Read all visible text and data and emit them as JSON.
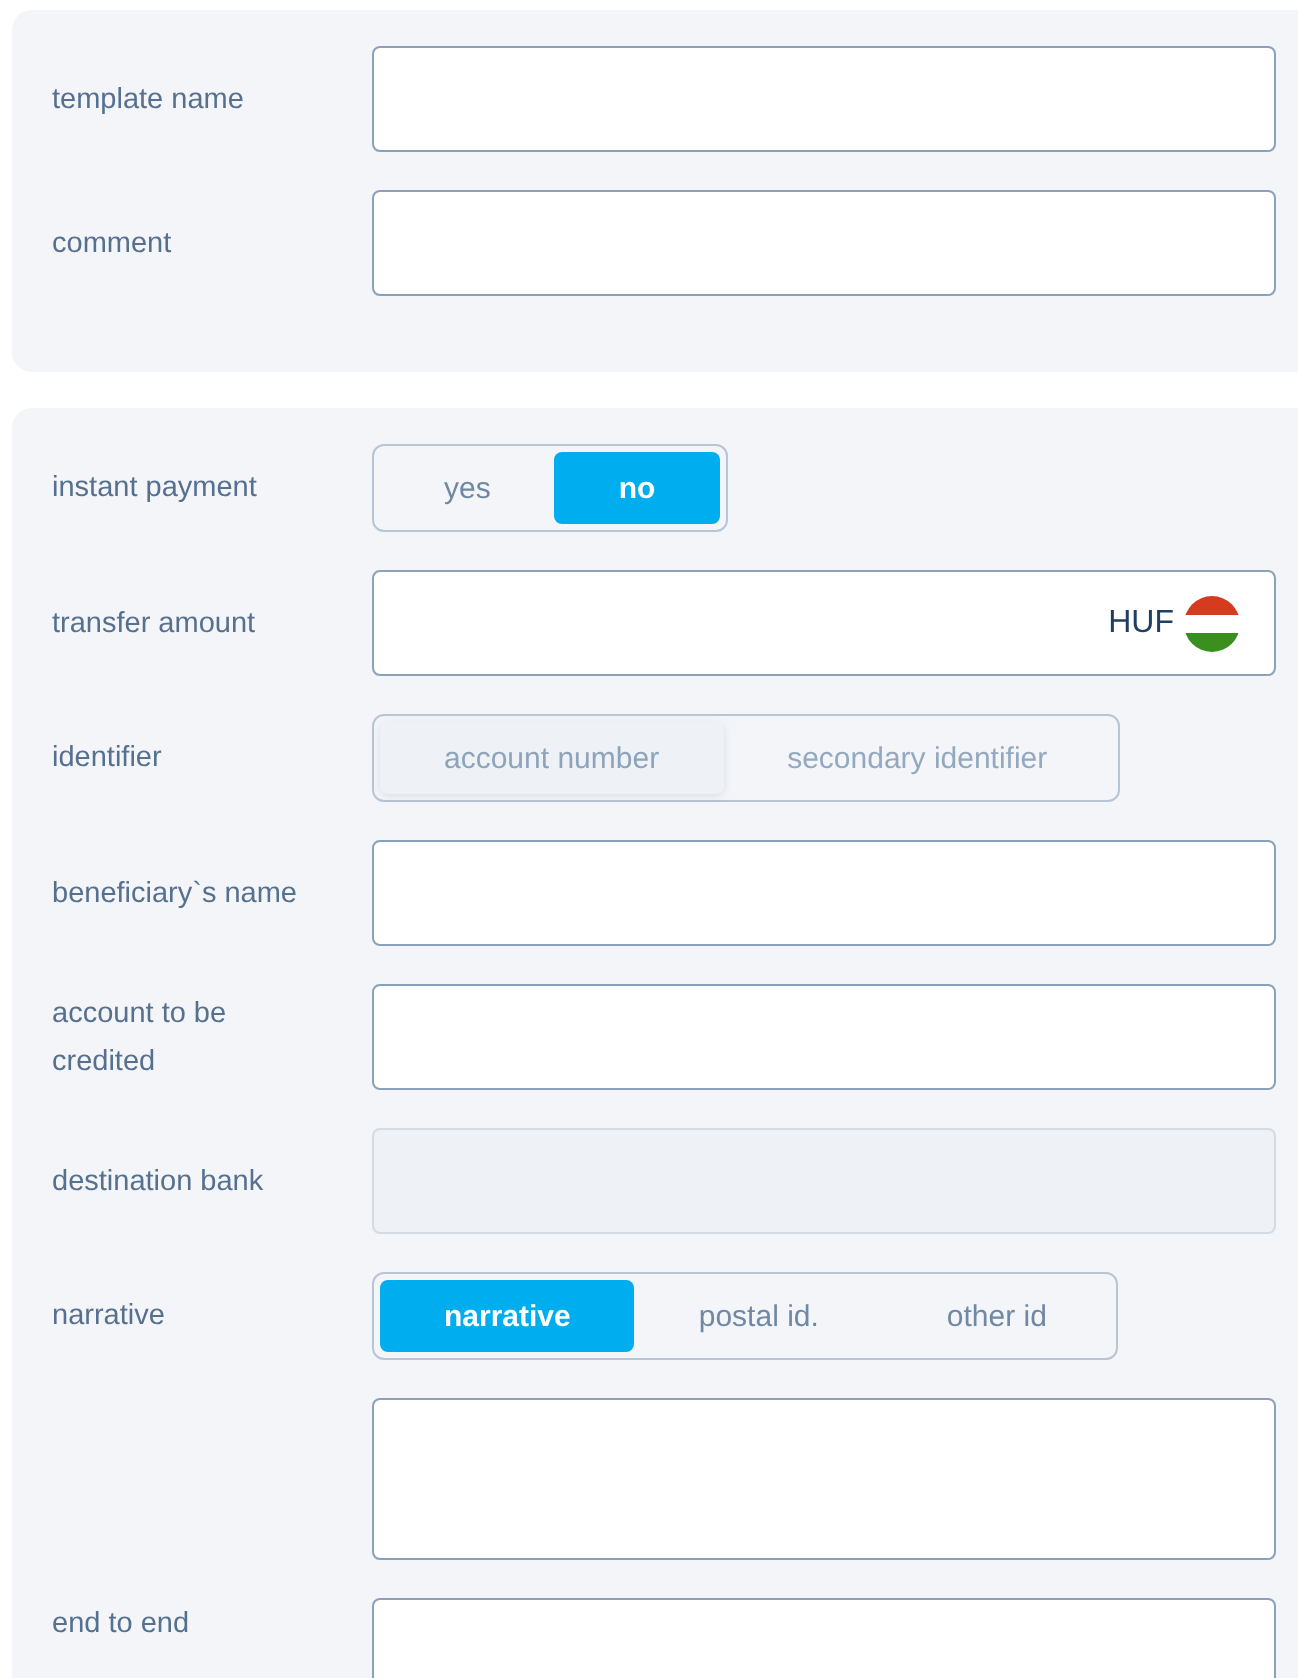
{
  "sections": [
    {
      "rows": [
        {
          "kind": "text",
          "label": "template name",
          "disabled": false
        },
        {
          "kind": "text",
          "label": "comment",
          "disabled": false
        }
      ]
    },
    {
      "rows": [
        {
          "kind": "segmented",
          "label": "instant payment",
          "disabled": false,
          "options": [
            {
              "label": "yes",
              "selected": false
            },
            {
              "label": "no",
              "selected": true
            }
          ]
        },
        {
          "kind": "amount",
          "label": "transfer amount",
          "currency": "HUF"
        },
        {
          "kind": "segmented",
          "label": "identifier",
          "disabled": true,
          "options": [
            {
              "label": "account number",
              "selected": true
            },
            {
              "label": "secondary identifier",
              "selected": false
            }
          ]
        },
        {
          "kind": "text",
          "label": "beneficiary`s name",
          "disabled": false
        },
        {
          "kind": "text",
          "label": "account to be credited",
          "disabled": false
        },
        {
          "kind": "text",
          "label": "destination bank",
          "disabled": true
        },
        {
          "kind": "segmented",
          "label": "narrative",
          "disabled": false,
          "options": [
            {
              "label": "narrative",
              "selected": true
            },
            {
              "label": "postal id.",
              "selected": false
            },
            {
              "label": "other id",
              "selected": false
            }
          ]
        },
        {
          "kind": "textarea"
        },
        {
          "kind": "text",
          "label": "end to end",
          "disabled": false
        }
      ]
    }
  ]
}
